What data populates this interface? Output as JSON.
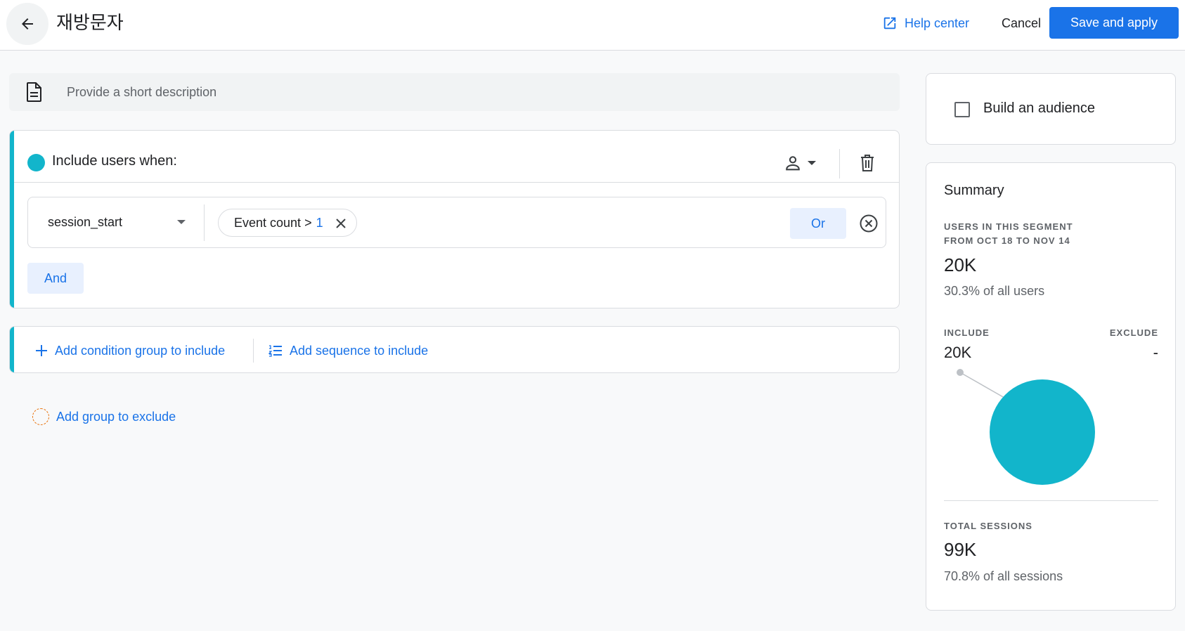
{
  "header": {
    "title": "재방문자",
    "help_label": "Help center",
    "cancel_label": "Cancel",
    "save_label": "Save and apply"
  },
  "description": {
    "placeholder": "Provide a short description",
    "value": ""
  },
  "include_group": {
    "title": "Include users when:",
    "condition": {
      "event_name": "session_start",
      "filter_label": "Event count >",
      "filter_value": "1"
    },
    "or_label": "Or",
    "and_label": "And"
  },
  "add_actions": {
    "add_condition_group": "Add condition group to include",
    "add_sequence": "Add sequence to include",
    "add_exclude": "Add group to exclude"
  },
  "audience": {
    "label": "Build an audience",
    "checked": false
  },
  "summary": {
    "title": "Summary",
    "users_caption_line1": "USERS IN THIS SEGMENT",
    "users_caption_line2": "FROM OCT 18 TO NOV 14",
    "users_value": "20K",
    "users_share": "30.3% of all users",
    "include_label": "INCLUDE",
    "exclude_label": "EXCLUDE",
    "include_value": "20K",
    "exclude_value": "-",
    "sessions_caption": "TOTAL SESSIONS",
    "sessions_value": "99K",
    "sessions_share": "70.8% of all sessions"
  },
  "colors": {
    "accent": "#12b5cb",
    "primary": "#1a73e8",
    "exclude": "#e8710a"
  }
}
